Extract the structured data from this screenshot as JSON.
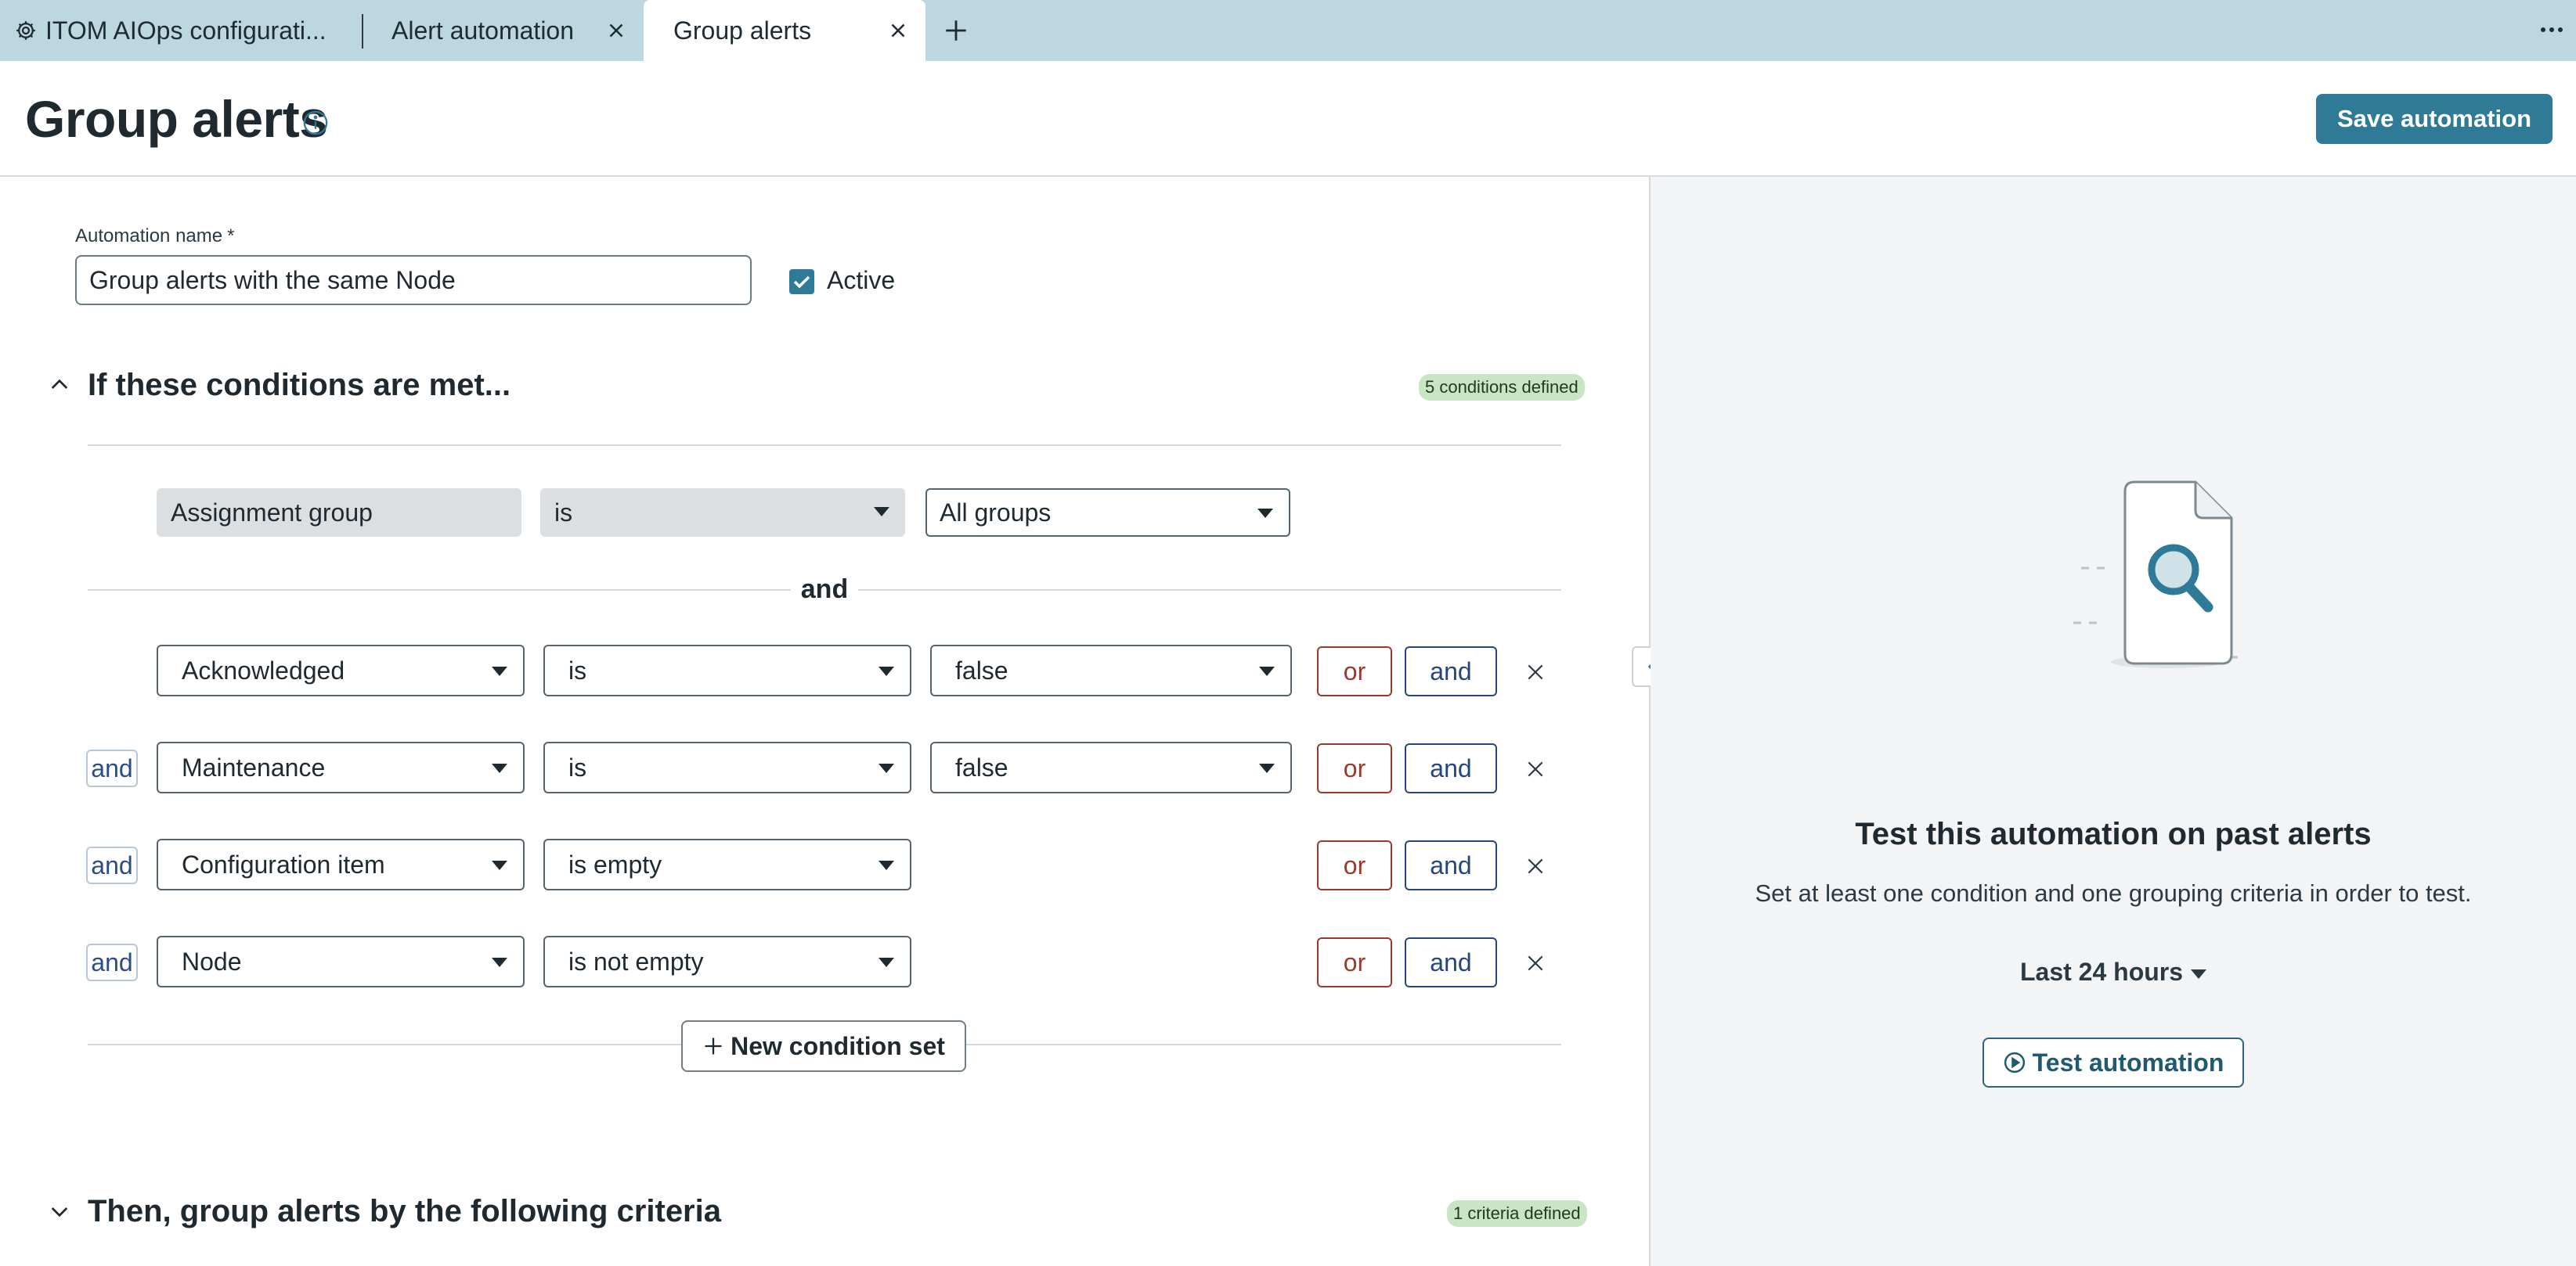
{
  "tabs": {
    "home_label": "ITOM AIOps configurati...",
    "automation_label": "Alert automation",
    "group_label": "Group alerts"
  },
  "header": {
    "title": "Group alerts",
    "save_label": "Save automation"
  },
  "form": {
    "name_label": "Automation name",
    "required_mark": "*",
    "name_value": "Group alerts with the same Node",
    "active_label": "Active",
    "active_checked": true
  },
  "conditions": {
    "title": "If these conditions are met...",
    "badge": "5 conditions defined",
    "base_row": {
      "field": "Assignment group",
      "operator": "is",
      "value": "All groups"
    },
    "separator": "and",
    "rows": [
      {
        "connector": "",
        "field": "Acknowledged",
        "operator": "is",
        "value": "false",
        "or_label": "or",
        "and_label": "and"
      },
      {
        "connector": "and",
        "field": "Maintenance",
        "operator": "is",
        "value": "false",
        "or_label": "or",
        "and_label": "and"
      },
      {
        "connector": "and",
        "field": "Configuration item",
        "operator": "is empty",
        "value": "",
        "or_label": "or",
        "and_label": "and"
      },
      {
        "connector": "and",
        "field": "Node",
        "operator": "is not empty",
        "value": "",
        "or_label": "or",
        "and_label": "and"
      }
    ],
    "new_set_label": "New condition set"
  },
  "grouping": {
    "title": "Then, group alerts by the following criteria",
    "badge": "1 criteria defined"
  },
  "test_panel": {
    "title": "Test this automation on past alerts",
    "subtitle": "Set at least one condition and one grouping criteria in order to test.",
    "range": "Last 24 hours",
    "button_label": "Test automation"
  },
  "colors": {
    "tabbar": "#bdd7e0",
    "primary": "#2f7a96",
    "or_color": "#9b3a2a",
    "and_color": "#24467e",
    "badge_bg": "#c8e6c3"
  }
}
